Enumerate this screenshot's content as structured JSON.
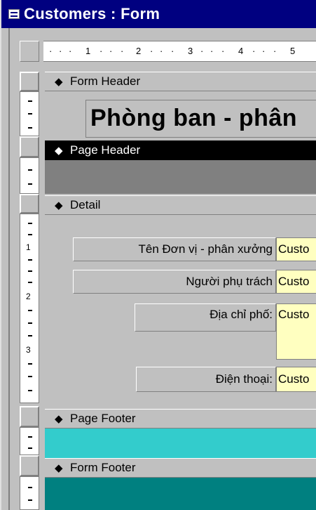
{
  "window": {
    "title": "Customers : Form",
    "icon": "form-icon"
  },
  "ruler": {
    "labels": [
      "1",
      "2",
      "3",
      "4",
      "5"
    ],
    "vertical_labels": [
      "1",
      "2",
      "3"
    ]
  },
  "sections": {
    "form_header": "Form Header",
    "page_header": "Page Header",
    "detail": "Detail",
    "page_footer": "Page Footer",
    "form_footer": "Form Footer"
  },
  "form_title": "Phòng ban - phân",
  "fields": [
    {
      "label": "Tên Đơn vị - phân xưởng",
      "value": "Custo"
    },
    {
      "label": "Người phụ trách",
      "value": "Custo"
    },
    {
      "label": "Địa chỉ phố:",
      "value": "Custo"
    },
    {
      "label": "Điện thoại:",
      "value": "Custo"
    }
  ],
  "colors": {
    "titlebar": "#000080",
    "page_footer_bg": "#33cccc",
    "form_footer_bg": "#008080",
    "field_bg": "#ffffc0"
  }
}
